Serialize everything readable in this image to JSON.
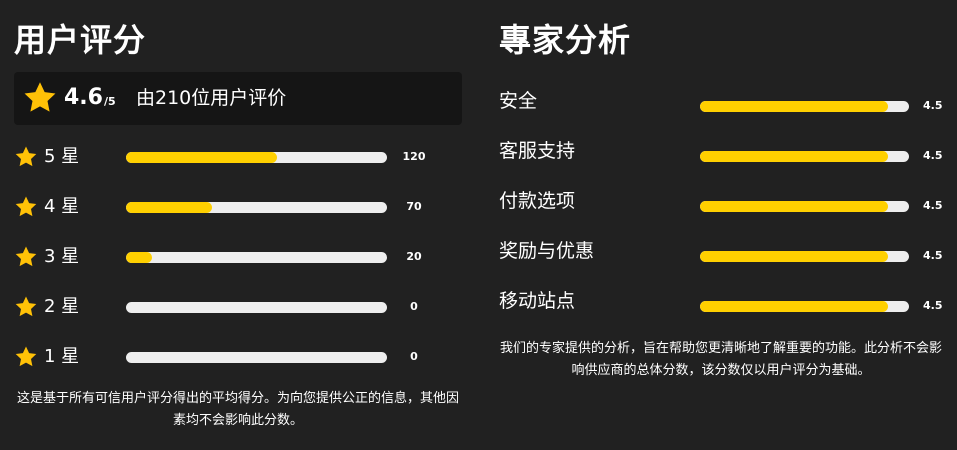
{
  "user_ratings": {
    "title": "用户评分",
    "score": "4.6",
    "out_of": "/5",
    "count_text": "由210位用户评价",
    "rows": [
      {
        "label": "5 星",
        "count": "120",
        "fill": 0.58
      },
      {
        "label": "4 星",
        "count": "70",
        "fill": 0.33
      },
      {
        "label": "3 星",
        "count": "20",
        "fill": 0.1
      },
      {
        "label": "2 星",
        "count": "0",
        "fill": 0
      },
      {
        "label": "1 星",
        "count": "0",
        "fill": 0
      }
    ],
    "note": "这是基于所有可信用户评分得出的平均得分。为向您提供公正的信息，其他因素均不会影响此分数。"
  },
  "expert_analysis": {
    "title": "專家分析",
    "rows": [
      {
        "label": "安全",
        "score": "4.5",
        "fill": 0.9
      },
      {
        "label": "客服支持",
        "score": "4.5",
        "fill": 0.9
      },
      {
        "label": "付款选项",
        "score": "4.5",
        "fill": 0.9
      },
      {
        "label": "奖励与优惠",
        "score": "4.5",
        "fill": 0.9
      },
      {
        "label": "移动站点",
        "score": "4.5",
        "fill": 0.9
      }
    ],
    "note": "我们的专家提供的分析，旨在帮助您更清晰地了解重要的功能。此分析不会影响供应商的总体分数，该分数仅以用户评分为基础。"
  },
  "colors": {
    "background": "#212121",
    "summary_box": "#151515",
    "bar_fill": "#ffd000",
    "bar_track": "#eeeeee",
    "star": "#ffc107"
  },
  "icons": {
    "rating_star": "star-icon"
  }
}
